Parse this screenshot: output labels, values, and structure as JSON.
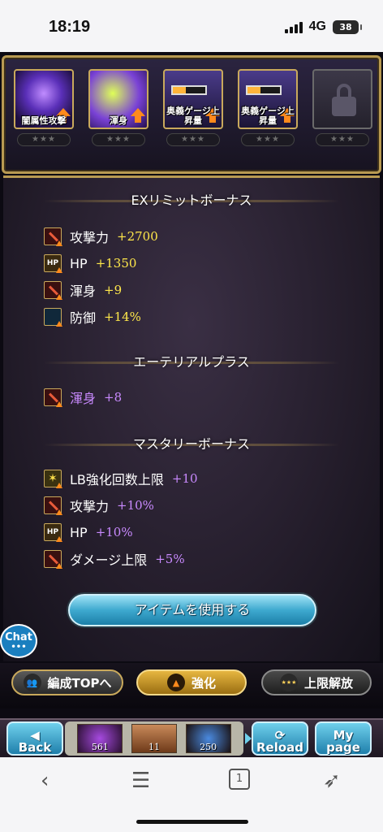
{
  "status": {
    "time": "18:19",
    "network": "4G",
    "battery": "38"
  },
  "skills": [
    {
      "label": "闇属性攻撃",
      "stars": "★★★",
      "icon": "dark-attack-icon"
    },
    {
      "label": "渾身",
      "stars": "★★★",
      "icon": "might-icon"
    },
    {
      "label": "奥義ゲージ上昇量",
      "stars": "★★★",
      "icon": "gauge-icon"
    },
    {
      "label": "奥義ゲージ上昇量",
      "stars": "★★★",
      "icon": "gauge-icon"
    },
    {
      "label": "",
      "stars": "★★★",
      "icon": "lock-icon"
    }
  ],
  "sections": {
    "ex_limit": {
      "title": "EXリミットボーナス",
      "rows": [
        {
          "name": "攻撃力",
          "value": "+2700",
          "icon": "attack-icon"
        },
        {
          "name": "HP",
          "value": "+1350",
          "icon": "hp-icon",
          "icon_text": "HP"
        },
        {
          "name": "渾身",
          "value": "+9",
          "icon": "attack-icon"
        },
        {
          "name": "防御",
          "value": "+14%",
          "icon": "defense-icon"
        }
      ]
    },
    "ethereal": {
      "title": "エーテリアルプラス",
      "rows": [
        {
          "name": "渾身",
          "value": "+8",
          "icon": "attack-icon"
        }
      ]
    },
    "mastery": {
      "title": "マスタリーボーナス",
      "rows": [
        {
          "name": "LB強化回数上限",
          "value": "+10",
          "icon": "lb-icon"
        },
        {
          "name": "攻撃力",
          "value": "+10%",
          "icon": "attack-icon"
        },
        {
          "name": "HP",
          "value": "+10%",
          "icon": "hp-icon",
          "icon_text": "HP"
        },
        {
          "name": "ダメージ上限",
          "value": "+5%",
          "icon": "attack-icon"
        }
      ]
    }
  },
  "item_button": "アイテムを使用する",
  "chat": {
    "label": "Chat",
    "dots": "•••"
  },
  "actions": {
    "team_top": "編成TOPへ",
    "enhance": "強化",
    "uncap": "上限解放",
    "uncap_stars": "★★★"
  },
  "nav": {
    "back": "Back",
    "reload": "Reload",
    "mypage_1": "My",
    "mypage_2": "page",
    "quick_items": [
      "561",
      "11",
      "250"
    ]
  },
  "browser": {
    "tab_count": "1"
  },
  "colors": {
    "gold": "#c9a95c",
    "yellow_value": "#ffe84a",
    "purple_value": "#c98aff",
    "accent_blue": "#3ea9cf"
  }
}
